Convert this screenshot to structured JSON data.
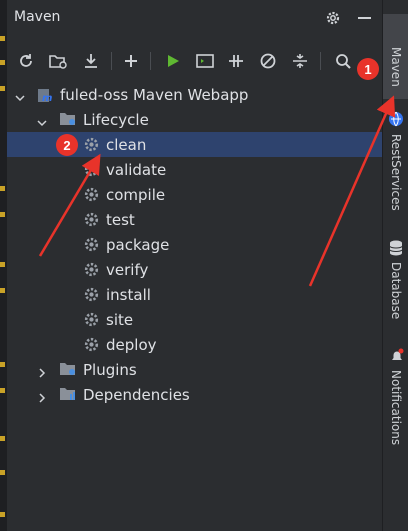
{
  "panel": {
    "title": "Maven",
    "project": "fuled-oss Maven Webapp",
    "lifecycle_label": "Lifecycle",
    "goals": [
      "clean",
      "validate",
      "compile",
      "test",
      "package",
      "verify",
      "install",
      "site",
      "deploy"
    ],
    "selected_goal": "clean",
    "plugins_label": "Plugins",
    "dependencies_label": "Dependencies"
  },
  "toolbar": {
    "icons": [
      "reload-icon",
      "add-folder-icon",
      "download-icon",
      "plus-icon",
      "run-icon",
      "terminal-icon",
      "toggle-offline-icon",
      "skip-tests-icon",
      "collapse-icon",
      "find-icon"
    ]
  },
  "right_strip": {
    "tabs": [
      "Maven",
      "RestServices",
      "Database",
      "Notifications"
    ]
  },
  "annotations": {
    "badge_1": "1",
    "badge_2": "2",
    "color": "#e8332a"
  },
  "colors": {
    "background": "#2b2d30",
    "selection": "#2e436e",
    "run_green": "#5fb832",
    "accent_blue": "#3574f0"
  }
}
